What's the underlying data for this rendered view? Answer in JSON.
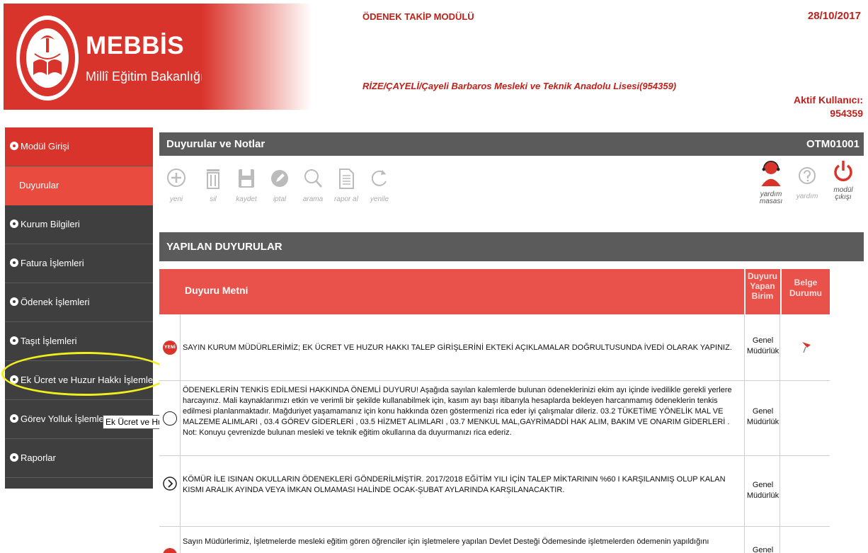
{
  "header": {
    "brand": "MEBBİS",
    "brand_sub": "Millî Eğitim Bakanlığı Bilişim Sistemleri",
    "module_title": "ÖDENEK TAKİP MODÜLÜ",
    "date": "28/10/2017",
    "school": "RİZE/ÇAYELİ/Çayeli Barbaros Mesleki ve Teknik Anadolu Lisesi(954359)",
    "user_label": "Aktif Kullanıcı:",
    "user_id": "954359"
  },
  "colors": {
    "brand_red": "#d9342b",
    "dark_gray": "#3f3f3f",
    "bar_gray": "#5b5b5b",
    "highlight": "#f2ee1d"
  },
  "sidebar": {
    "items": [
      {
        "label": "Modül Girişi"
      },
      {
        "label": "Duyurular"
      },
      {
        "label": "Kurum Bilgileri"
      },
      {
        "label": "Fatura İşlemleri"
      },
      {
        "label": "Ödenek İşlemleri"
      },
      {
        "label": "Taşıt İşlemleri"
      },
      {
        "label": "Ek Ücret ve Huzur Hakkı İşlemleri"
      },
      {
        "label": "Görev Yolluk İşlemleri"
      },
      {
        "label": "Raporlar"
      }
    ],
    "tooltip": "Ek Ücret ve Huzur Hakkı İşlemleri"
  },
  "main": {
    "title": "Duyurular ve Notlar",
    "code": "OTM01001",
    "toolbar": {
      "new": "yeni",
      "delete": "sil",
      "save": "kaydet",
      "cancel": "iptal",
      "search": "arama",
      "report": "rapor al",
      "refresh": "yenile",
      "helpdesk_1": "yardım",
      "helpdesk_2": "masası",
      "help": "yardım",
      "exit_1": "modül",
      "exit_2": "çıkışı"
    },
    "section_title": "YAPILAN DUYURULAR",
    "table": {
      "col_text": "Duyuru Metni",
      "col_unit_1": "Duyuru",
      "col_unit_2": "Yapan",
      "col_unit_3": "Birim",
      "col_doc_1": "Belge",
      "col_doc_2": "Durumu",
      "rows": [
        {
          "badge": "YENİ",
          "text": "SAYIN KURUM MÜDÜRLERİMİZ; EK ÜCRET VE HUZUR HAKKI TALEP GİRİŞLERİNİ EKTEKİ AÇIKLAMALAR DOĞRULTUSUNDA İVEDİ OLARAK YAPINIZ.",
          "unit_1": "Genel",
          "unit_2": "Müdürlük"
        },
        {
          "text": "ÖDENEKLERİN TENKİS EDİLMESİ HAKKINDA ÖNEMLİ DUYURU! Aşağıda sayılan kalemlerde bulunan ödeneklerinizi ekim ayı içinde ivedilikle gerekli yerlere harcayınız. Mali kaynaklarımızı etkin ve verimli bir şekilde kullanabilmek için, kasım ayı başı itibarıyla hesaplarda bekleyen harcanmamış ödeneklerin tenkis edilmesi planlanmaktadır. Mağduriyet yaşamamanız için konu hakkında özen göstermenizi rica eder iyi çalışmalar dileriz. 03.2 TÜKETİME YÖNELİK MAL VE MALZEME ALIMLARI , 03.4 GÖREV GİDERLERİ , 03.5 HİZMET ALIMLARI , 03.7 MENKUL MAL,GAYRİMADDİ HAK ALIM, BAKIM VE ONARIM GİDERLERİ . Not: Konuyu çevrenizde bulunan mesleki ve teknik eğitim okullarına da duyurmanızı rica ederiz.",
          "unit_1": "Genel",
          "unit_2": "Müdürlük"
        },
        {
          "text": "KÖMÜR İLE ISINAN OKULLARIN ÖDENEKLERİ GÖNDERİLMİŞTİR. 2017/2018 EĞİTİM YILI İÇİN TALEP MİKTARININ %60 I KARŞILANMIŞ OLUP KALAN KISMI ARALIK AYINDA VEYA İMKAN OLMAMASI HALİNDE OCAK-ŞUBAT AYLARINDA KARŞILANACAKTIR.",
          "unit_1": "Genel",
          "unit_2": "Müdürlük"
        },
        {
          "text": "Sayın Müdürlerimiz, İşletmelerde mesleki eğitim gören öğrenciler için işletmelere yapılan Devlet Desteği Ödemesinde işletmelerden ödemenin yapıldığını",
          "unit_1": "Genel"
        }
      ]
    }
  }
}
